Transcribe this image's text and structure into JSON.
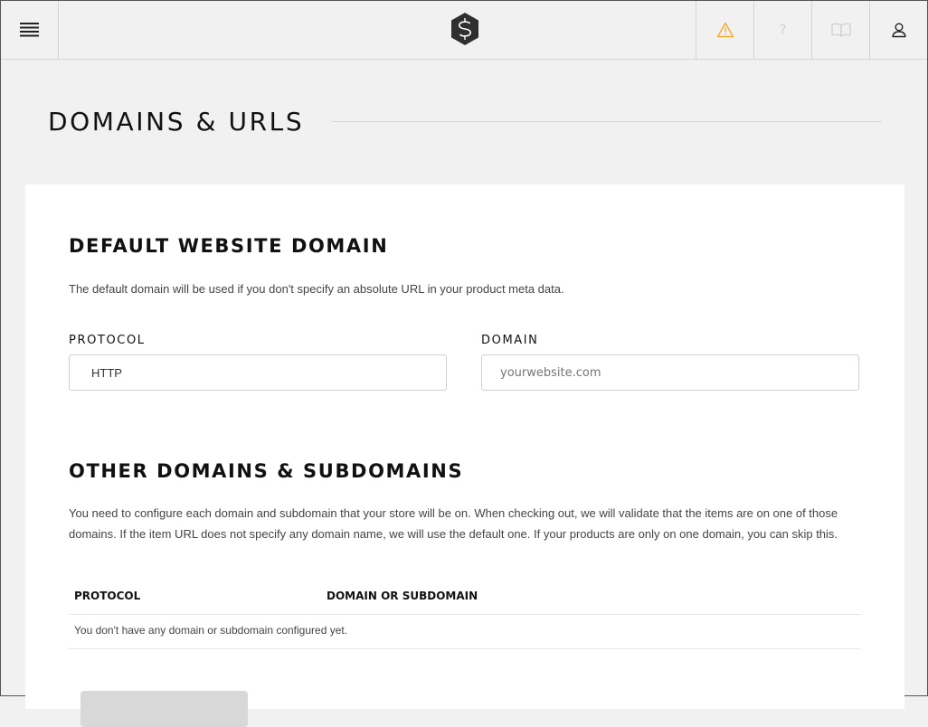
{
  "topbar": {
    "menu_icon": "hamburger-menu-icon",
    "logo_icon": "snipcart-logo-icon",
    "warning_icon": "warning-triangle-icon",
    "help_icon": "question-mark-icon",
    "help_glyph": "?",
    "docs_icon": "open-book-icon",
    "user_icon": "user-profile-icon",
    "warning_color": "#f5a623"
  },
  "page": {
    "title": "DOMAINS & URLS"
  },
  "default_domain": {
    "title": "DEFAULT WEBSITE DOMAIN",
    "description": "The default domain will be used if you don't specify an absolute URL in your product meta data.",
    "protocol_label": "PROTOCOL",
    "protocol_value": "HTTP",
    "domain_label": "DOMAIN",
    "domain_placeholder": "yourwebsite.com"
  },
  "other_domains": {
    "title": "OTHER DOMAINS & SUBDOMAINS",
    "description_line1": "You need to configure each domain and subdomain that your store will be on. When checking out, we will validate that the items are on one of those",
    "description_line2": "domains. If the item URL does not specify any domain name, we will use the default one. If your products are only on one domain, you can skip this.",
    "table": {
      "columns": [
        "PROTOCOL",
        "DOMAIN OR SUBDOMAIN"
      ],
      "empty_message": "You don't have any domain or subdomain configured yet."
    }
  }
}
